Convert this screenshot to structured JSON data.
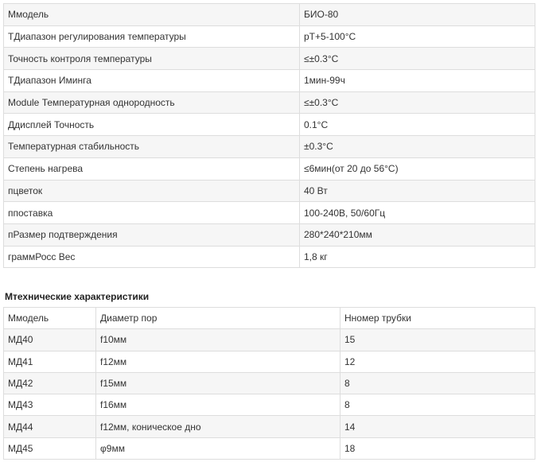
{
  "specs": {
    "rows": [
      {
        "name": "Ммодель",
        "value": "БИО-80"
      },
      {
        "name": "TДиапазон регулирования температуры",
        "value": "рТ+5-100°C"
      },
      {
        "name": "Точность контроля температуры",
        "value": "≤±0.3°C"
      },
      {
        "name": "TДиапазон Иминга",
        "value": "1мин-99ч"
      },
      {
        "name": "Module Температурная однородность",
        "value": "≤±0.3°C"
      },
      {
        "name": "Ддисплей Точность",
        "value": "0.1°C"
      },
      {
        "name": "Температурная стабильность",
        "value": "±0.3°C"
      },
      {
        "name": "Степень нагрева",
        "value": "≤6мин(от 20 до 56°C)"
      },
      {
        "name": "пцветок",
        "value": "40 Вт"
      },
      {
        "name": "ппоставка",
        "value": "100-240В, 50/60Гц"
      },
      {
        "name": "пРазмер подтверждения",
        "value": "280*240*210мм"
      },
      {
        "name": "граммРосс Вес",
        "value": "1,8 кг"
      }
    ]
  },
  "section_heading": "Мтехнические характеристики",
  "models": {
    "headers": [
      "Ммодель",
      "Диаметр пор",
      "Нномер трубки"
    ],
    "rows": [
      [
        "МД40",
        "f10мм",
        "15"
      ],
      [
        "МД41",
        "f12мм",
        "12"
      ],
      [
        "МД42",
        "f15мм",
        "8"
      ],
      [
        "МД43",
        "f16мм",
        "8"
      ],
      [
        "МД44",
        "f12мм, коническое дно",
        "14"
      ],
      [
        "МД45",
        "φ9мм",
        "18"
      ]
    ]
  }
}
